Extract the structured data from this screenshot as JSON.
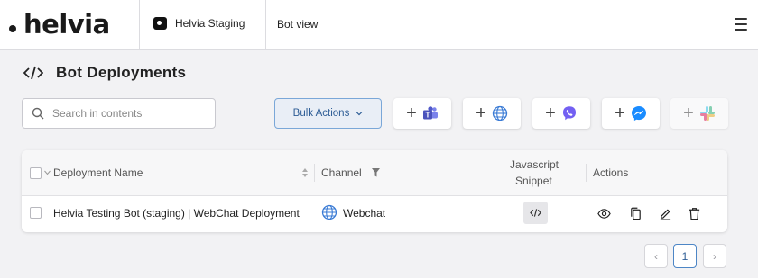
{
  "header": {
    "logo_text": "helvia",
    "workspace": "Helvia Staging",
    "bot_view": "Bot view"
  },
  "page": {
    "title": "Bot Deployments"
  },
  "toolbar": {
    "search_placeholder": "Search in contents",
    "bulk_actions_label": "Bulk Actions",
    "add_channel_buttons": [
      {
        "icon": "teams-icon",
        "color": "#5059c9"
      },
      {
        "icon": "webchat-globe-icon",
        "color": "#3a7bd5"
      },
      {
        "icon": "viber-icon",
        "color": "#7360f2"
      },
      {
        "icon": "messenger-icon",
        "color": "#1a8cff"
      },
      {
        "icon": "slack-icon",
        "color": "#e01e5a"
      }
    ]
  },
  "table": {
    "columns": {
      "name": "Deployment Name",
      "channel": "Channel",
      "snippet_line1": "Javascript",
      "snippet_line2": "Snippet",
      "actions": "Actions"
    },
    "rows": [
      {
        "name": "Helvia Testing Bot (staging) | WebChat Deployment",
        "channel": "Webchat",
        "actions": [
          "view-icon",
          "copy-icon",
          "edit-icon",
          "delete-icon"
        ]
      }
    ]
  },
  "pagination": {
    "prev": "‹",
    "current": "1",
    "next": "›"
  },
  "colors": {
    "accent": "#2e5d96",
    "accent_border": "#7aa7d8",
    "background": "#f2f2f4"
  }
}
